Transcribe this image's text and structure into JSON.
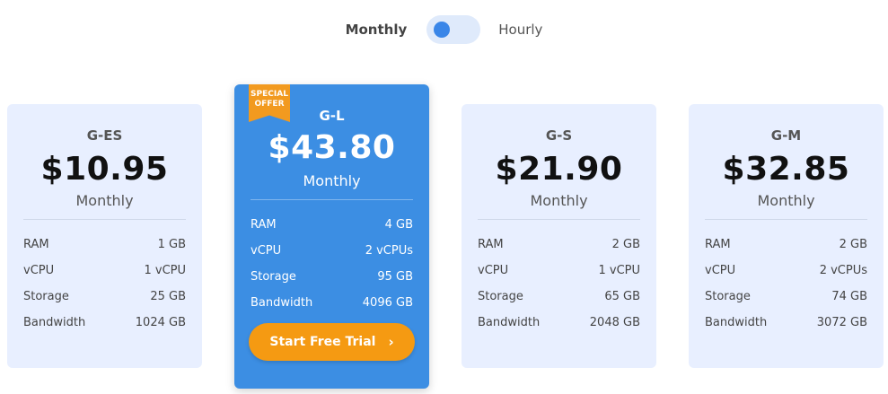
{
  "billing_toggle": {
    "left_label": "Monthly",
    "right_label": "Hourly",
    "selected": "Monthly"
  },
  "plans": [
    {
      "name": "G-ES",
      "price": "$10.95",
      "period": "Monthly",
      "specs": [
        {
          "label": "RAM",
          "value": "1 GB"
        },
        {
          "label": "vCPU",
          "value": "1 vCPU"
        },
        {
          "label": "Storage",
          "value": "25 GB"
        },
        {
          "label": "Bandwidth",
          "value": "1024 GB"
        }
      ]
    },
    {
      "name": "G-L",
      "price": "$43.80",
      "period": "Monthly",
      "badge": "SPECIAL OFFER",
      "badge_line1": "SPECIAL",
      "badge_line2": "OFFER",
      "cta": "Start Free Trial",
      "specs": [
        {
          "label": "RAM",
          "value": "4 GB"
        },
        {
          "label": "vCPU",
          "value": "2 vCPUs"
        },
        {
          "label": "Storage",
          "value": "95 GB"
        },
        {
          "label": "Bandwidth",
          "value": "4096 GB"
        }
      ]
    },
    {
      "name": "G-S",
      "price": "$21.90",
      "period": "Monthly",
      "specs": [
        {
          "label": "RAM",
          "value": "2 GB"
        },
        {
          "label": "vCPU",
          "value": "1 vCPU"
        },
        {
          "label": "Storage",
          "value": "65 GB"
        },
        {
          "label": "Bandwidth",
          "value": "2048 GB"
        }
      ]
    },
    {
      "name": "G-M",
      "price": "$32.85",
      "period": "Monthly",
      "specs": [
        {
          "label": "RAM",
          "value": "2 GB"
        },
        {
          "label": "vCPU",
          "value": "2 vCPUs"
        },
        {
          "label": "Storage",
          "value": "74 GB"
        },
        {
          "label": "Bandwidth",
          "value": "3072 GB"
        }
      ]
    }
  ],
  "colors": {
    "card_background": "#e8efff",
    "featured_background": "#3c8ee3",
    "badge": "#f29a1f",
    "cta": "#f59a12",
    "toggle_knob": "#3a86e8"
  },
  "icons": {
    "cta_chevron": "chevron-right-icon"
  }
}
